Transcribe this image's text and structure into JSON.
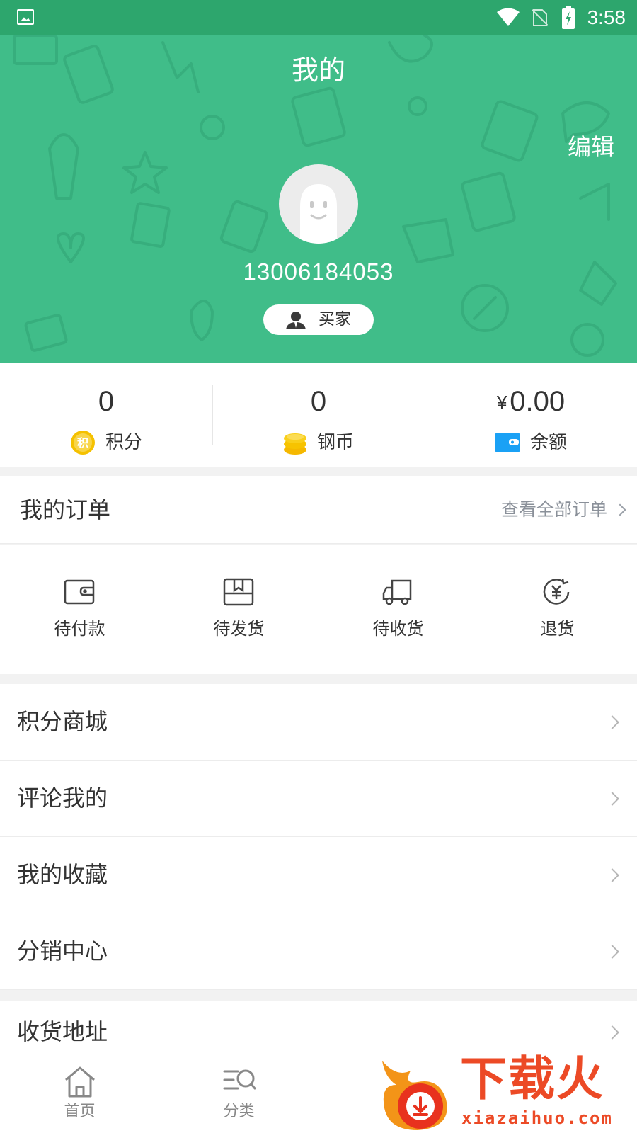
{
  "status_bar": {
    "time": "3:58"
  },
  "header": {
    "title": "我的",
    "edit_label": "编辑",
    "phone": "13006184053",
    "role": "买家"
  },
  "stats": [
    {
      "value": "0",
      "label": "积分",
      "icon": "points-icon",
      "icon_text": "积"
    },
    {
      "value": "0",
      "label": "钢币",
      "icon": "coins-icon"
    },
    {
      "currency": "¥",
      "value": "0.00",
      "label": "余额",
      "icon": "wallet-icon"
    }
  ],
  "orders": {
    "title": "我的订单",
    "view_all": "查看全部订单",
    "items": [
      {
        "label": "待付款",
        "icon": "wallet-outline-icon"
      },
      {
        "label": "待发货",
        "icon": "box-icon"
      },
      {
        "label": "待收货",
        "icon": "truck-icon"
      },
      {
        "label": "退货",
        "icon": "refund-icon"
      }
    ]
  },
  "menu": [
    {
      "label": "积分商城"
    },
    {
      "label": "评论我的"
    },
    {
      "label": "我的收藏"
    },
    {
      "label": "分销中心"
    },
    {
      "label": "收货地址"
    }
  ],
  "tab_bar": [
    {
      "label": "首页",
      "icon": "home-icon"
    },
    {
      "label": "分类",
      "icon": "category-search-icon"
    }
  ],
  "watermark": {
    "main": "下载火",
    "sub": "xiazaihuo.com"
  },
  "colors": {
    "brand_green": "#40bd89",
    "status_green": "#2da66d",
    "coin_yellow": "#f5c100",
    "wallet_blue": "#1aa1f5"
  }
}
